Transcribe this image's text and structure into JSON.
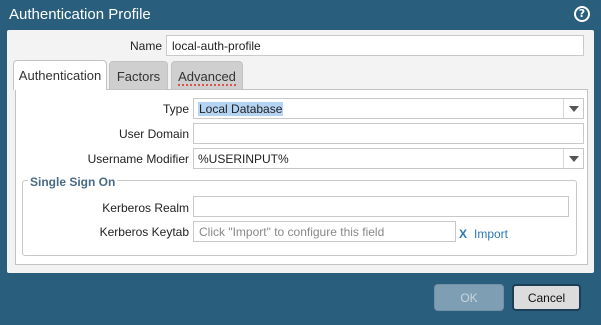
{
  "dialog": {
    "title": "Authentication Profile",
    "help_icon": "?"
  },
  "name": {
    "label": "Name",
    "value": "local-auth-profile"
  },
  "tabs": [
    {
      "label": "Authentication",
      "active": true
    },
    {
      "label": "Factors",
      "active": false
    },
    {
      "label": "Advanced",
      "active": false
    }
  ],
  "authentication": {
    "type": {
      "label": "Type",
      "value": "Local Database"
    },
    "user_domain": {
      "label": "User Domain",
      "value": ""
    },
    "username_modifier": {
      "label": "Username Modifier",
      "value": "%USERINPUT%"
    }
  },
  "sso": {
    "legend": "Single Sign On",
    "kerberos_realm": {
      "label": "Kerberos Realm",
      "value": ""
    },
    "kerberos_keytab": {
      "label": "Kerberos Keytab",
      "placeholder": "Click \"Import\" to configure this field"
    },
    "clear_icon": "X",
    "import_label": "Import"
  },
  "buttons": {
    "ok": "OK",
    "cancel": "Cancel"
  },
  "colors": {
    "titlebar": "#2a5e7d",
    "accent": "#2e78b5",
    "legend": "#4a6b85"
  }
}
